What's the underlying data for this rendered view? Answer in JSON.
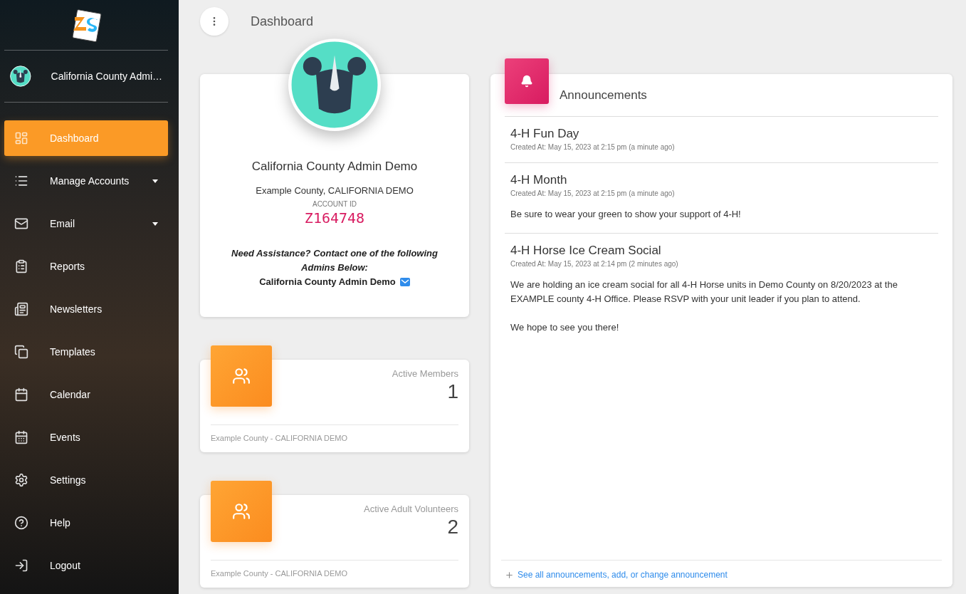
{
  "sidebar": {
    "user": {
      "name": "California County Admi…"
    },
    "items": [
      {
        "label": "Dashboard",
        "selected": true,
        "has_menu": false
      },
      {
        "label": "Manage Accounts",
        "selected": false,
        "has_menu": true
      },
      {
        "label": "Email",
        "selected": false,
        "has_menu": true
      },
      {
        "label": "Reports",
        "selected": false,
        "has_menu": false
      },
      {
        "label": "Newsletters",
        "selected": false,
        "has_menu": false
      },
      {
        "label": "Templates",
        "selected": false,
        "has_menu": false
      },
      {
        "label": "Calendar",
        "selected": false,
        "has_menu": false
      },
      {
        "label": "Events",
        "selected": false,
        "has_menu": false
      },
      {
        "label": "Settings",
        "selected": false,
        "has_menu": false
      },
      {
        "label": "Help",
        "selected": false,
        "has_menu": false
      },
      {
        "label": "Logout",
        "selected": false,
        "has_menu": false
      }
    ]
  },
  "header": {
    "title": "Dashboard"
  },
  "profile": {
    "name": "California County Admin Demo",
    "county": "Example County, CALIFORNIA DEMO",
    "account_id_label": "ACCOUNT ID",
    "account_id": "Z164748",
    "assistance": "Need Assistance? Contact one of the following Admins Below:",
    "admin": "California County Admin Demo"
  },
  "stats": [
    {
      "label": "Active Members",
      "value": "1",
      "footer": "Example County - CALIFORNIA DEMO"
    },
    {
      "label": "Active Adult Volunteers",
      "value": "2",
      "footer": "Example County - CALIFORNIA DEMO"
    }
  ],
  "announcements": {
    "title": "Announcements",
    "items": [
      {
        "title": "4-H Fun Day",
        "created": "Created At: May 15, 2023 at 2:15 pm (a minute ago)"
      },
      {
        "title": "4-H Month",
        "created": "Created At: May 15, 2023 at 2:15 pm (a minute ago)",
        "body": [
          "Be sure to wear your green to show your support of 4-H!"
        ]
      },
      {
        "title": "4-H Horse Ice Cream Social",
        "created": "Created At: May 15, 2023 at 2:14 pm (2 minutes ago)",
        "body": [
          "We are holding an ice cream social for all 4-H Horse units in Demo County on 8/20/2023 at the EXAMPLE county 4-H Office. Please RSVP with your unit leader if you plan to attend.",
          "We hope to see you there!"
        ]
      }
    ],
    "footer_link": "See all announcements, add, or change announcement"
  }
}
